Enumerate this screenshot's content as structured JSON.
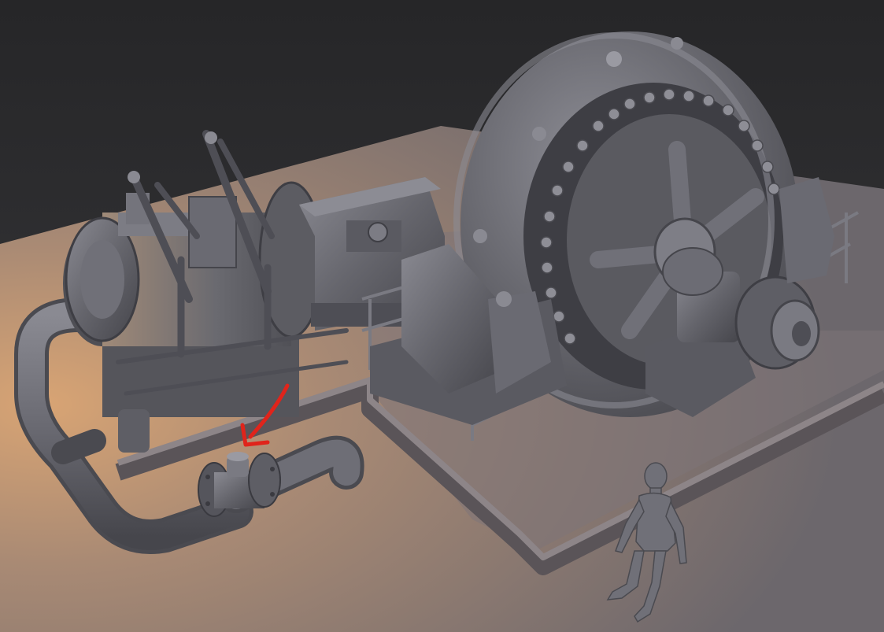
{
  "scene": {
    "subject": "steam-engine-generator-render",
    "colors": {
      "background": "#2f2f31",
      "floor_warm": "#c99a6e",
      "floor_cool": "#6e6a6e",
      "model": "#6a6a70",
      "model_dark": "#4a4a50",
      "model_light": "#8e8e96",
      "annotation_arrow": "#e0241b"
    },
    "annotation": {
      "type": "hand-drawn-arrow",
      "color": "#e0241b",
      "points_to": "pipe-valve-fitting"
    },
    "elements": [
      "base-platform",
      "steam-cylinder",
      "valve-linkage",
      "crosshead-guide",
      "flywheel-generator",
      "armature-coils",
      "exciter-bearing",
      "guard-railings",
      "steam-pipe",
      "pipe-valve",
      "human-scale-figure"
    ]
  }
}
